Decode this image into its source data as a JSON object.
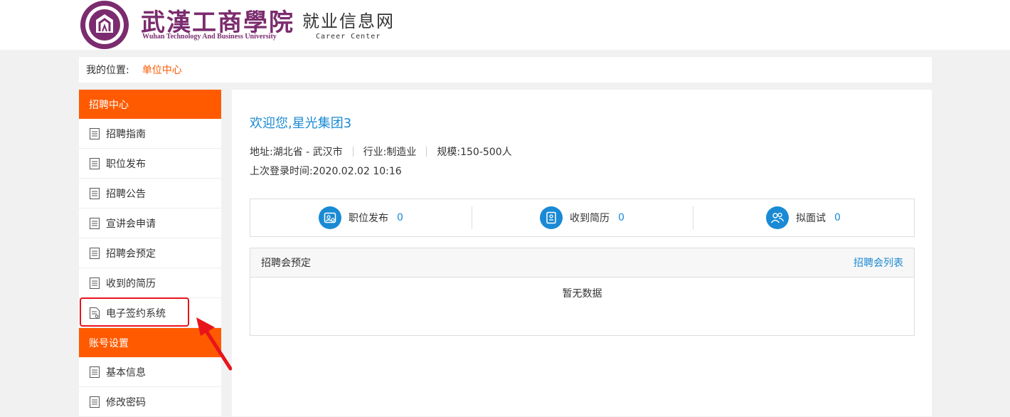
{
  "header": {
    "cn_name": "武漢工商學院",
    "en_name": "Wuhan Technology And Business University",
    "site_title": "就业信息网",
    "site_subtitle": "Career Center",
    "logo_icon": "university-seal-icon"
  },
  "breadcrumb": {
    "label": "我的位置:",
    "current": "单位中心"
  },
  "sidebar": {
    "section1_title": "招聘中心",
    "items": [
      {
        "label": "招聘指南",
        "icon": "document-icon"
      },
      {
        "label": "职位发布",
        "icon": "document-icon"
      },
      {
        "label": "招聘公告",
        "icon": "document-icon"
      },
      {
        "label": "宣讲会申请",
        "icon": "document-icon"
      },
      {
        "label": "招聘会预定",
        "icon": "document-icon"
      },
      {
        "label": "收到的简历",
        "icon": "document-icon"
      },
      {
        "label": "电子签约系统",
        "icon": "contract-icon"
      }
    ],
    "section2_title": "账号设置",
    "items2": [
      {
        "label": "基本信息",
        "icon": "document-icon"
      },
      {
        "label": "修改密码",
        "icon": "document-icon"
      }
    ]
  },
  "main": {
    "welcome": "欢迎您,星光集团3",
    "address": "地址:湖北省 - 武汉市",
    "industry": "行业:制造业",
    "scale": "规模:150-500人",
    "last_login": "上次登录时间:2020.02.02 10:16",
    "stats": [
      {
        "label": "职位发布",
        "value": "0",
        "icon": "job-card-icon"
      },
      {
        "label": "收到简历",
        "value": "0",
        "icon": "resume-icon"
      },
      {
        "label": "拟面试",
        "value": "0",
        "icon": "interview-people-icon"
      }
    ],
    "fair": {
      "title": "招聘会预定",
      "link": "招聘会列表",
      "empty": "暂无数据"
    }
  },
  "colors": {
    "accent_orange": "#ff5a00",
    "accent_blue": "#1a8ad4",
    "brand_purple": "#7b2c6e",
    "highlight_red": "#e8141b"
  }
}
